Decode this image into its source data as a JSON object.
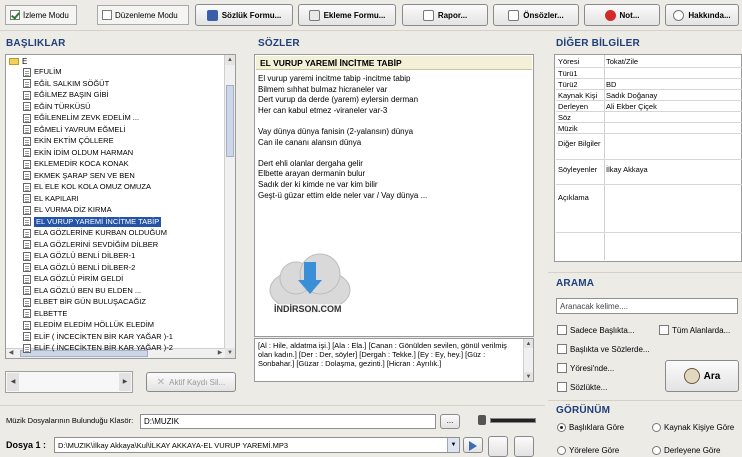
{
  "toolbar": {
    "mode_view": "İzleme Modu",
    "mode_edit": "Düzenleme Modu",
    "buttons": [
      "Sözlük Formu...",
      "Ekleme Formu...",
      "Rapor...",
      "Önsözler...",
      "Not...",
      "Hakkında..."
    ]
  },
  "titles": {
    "basliklar": "BAŞLIKLAR",
    "sozler": "SÖZLER",
    "diger": "DİĞER BİLGİLER",
    "arama": "ARAMA",
    "gorunum": "GÖRÜNÜM"
  },
  "tree": {
    "root": "E",
    "items": [
      "EFULİM",
      "EĞİL SALKIM SÖĞÜT",
      "EĞİLMEZ BAŞIN GİBİ",
      "EĞİN TÜRKÜSÜ",
      "EĞİLENELİM ZEVK EDELİM ...",
      "EĞMELİ YAVRUM EĞMELİ",
      "EKİN EKTİM ÇÖLLERE",
      "EKİN İDİM OLDUM HARMAN",
      "EKLEMEDİR KOCA KONAK",
      "EKMEK ŞARAP SEN VE BEN",
      "EL ELE KOL KOLA OMUZ OMUZA",
      "EL KAPILARI",
      "EL VURMA DİZ KIRMA",
      "EL VURUP YAREMİ İNCİTME TABİP",
      "ELA GÖZLERİNE KURBAN OLDUĞUM",
      "ELA GÖZLERİNİ SEVDİĞİM DİLBER",
      "ELA GÖZLÜ BENLİ DİLBER-1",
      "ELA GÖZLÜ BENLİ DİLBER-2",
      "ELA GÖZLÜ PİRİM GELDİ",
      "ELA GÖZLÜ BEN BU ELDEN ...",
      "ELBET BİR GÜN BULUŞACAĞIZ",
      "ELBETTE",
      "ELEDİM ELEDİM HÖLLÜK ELEDİM",
      "ELİF ( İNCECİKTEN BİR KAR YAĞAR )-1",
      "ELİF ( İNCECİKTEN BİR KAR YAĞAR )-2"
    ],
    "selected_index": 13,
    "delete_button": "Aktif Kaydı Sil..."
  },
  "lyrics": {
    "title": "EL VURUP YAREMİ İNCİTME TABİP",
    "lines": [
      "El vurup yaremi incitme tabip -incitme tabip",
      "Bilmem sıhhat bulmaz hicraneler var",
      "Dert vurup da derde (yarem) eylersin derman",
      "Her can kabul etmez -viraneler var-3",
      "",
      "Vay dünya dünya fanisin (2-yalansın) dünya",
      "Can ile cananı alansın dünya",
      "",
      "Dert ehli olanlar dergaha gelir",
      "Elbette arayan dermanin bulur",
      "Sadık der ki kimde ne var kim bilir",
      "Geşt-ü güzar ettim elde neler var  /  Vay dünya ..."
    ],
    "glossary": "[Al : Hile, aldatma işi.]  [Ala : Ela.]  [Canan : Gönülden sevilen, gönül verilmiş olan kadın.]  [Der : Der, söyler]  [Dergah : Tekke.]  [Ey : Ey, hey.]  [Güz : Sonbahar.]  [Güzar : Dolaşma, gezinti.]  [Hicran : Ayrılık.]"
  },
  "watermark": {
    "text": "İNDİRSON.COM"
  },
  "info": {
    "rows": [
      {
        "key": "Yöresi",
        "value": "Tokat/Zile"
      },
      {
        "key": "Türü1",
        "value": ""
      },
      {
        "key": "Türü2",
        "value": "BD"
      },
      {
        "key": "Kaynak Kişi",
        "value": "Sadık Doğanay"
      },
      {
        "key": "Derleyen",
        "value": "Ali Ekber Çiçek"
      },
      {
        "key": "Söz",
        "value": ""
      },
      {
        "key": "Müzik",
        "value": ""
      },
      {
        "key": "Diğer Bilgiler",
        "value": ""
      },
      {
        "key": "Söyleyenler",
        "value": "İlkay Akkaya"
      },
      {
        "key": "Açıklama",
        "value": ""
      }
    ]
  },
  "search": {
    "placeholder": "Aranacak kelime....",
    "options": [
      "Sadece Başlıkta...",
      "Tüm Alanlarda...",
      "Başlıkta ve Sözlerde...",
      "Yöresi'nde...",
      "Sözlükte..."
    ],
    "button": "Ara"
  },
  "view": {
    "options": [
      "Başlıklara Göre",
      "Kaynak Kişiye Göre",
      "Yörelere Göre",
      "Derleyene Göre"
    ],
    "selected_index": 0
  },
  "music": {
    "folder_label": "Müzik Dosyalarının Bulunduğu Klasör:",
    "folder_value": "D:\\MUZIK",
    "file_label": "Dosya 1 :",
    "file_value": "D:\\MUZIK\\İlkay Akkaya\\Kul\\İLKAY AKKAYA-EL VURUP YAREMİ.MP3",
    "browse": "..."
  },
  "colors": {
    "title_blue": "#1f3f7a",
    "selection": "#2454a8",
    "not_red": "#d22a2a"
  }
}
